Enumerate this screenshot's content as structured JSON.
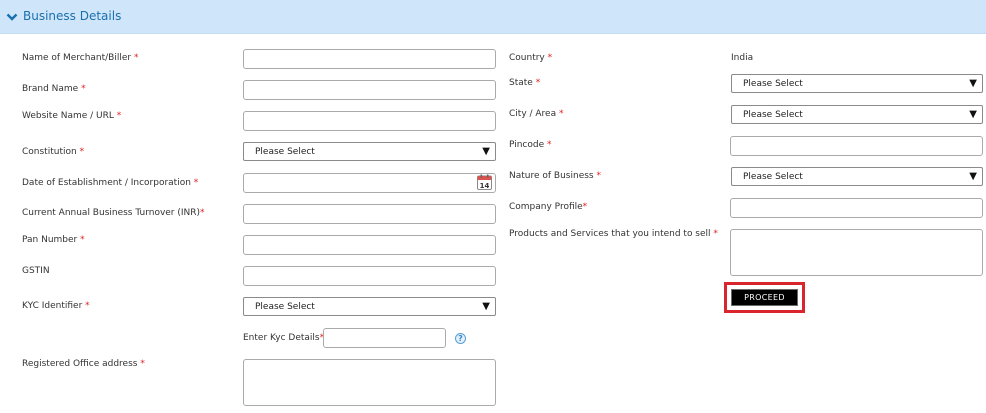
{
  "section": {
    "title": "Business Details"
  },
  "left": {
    "merchant_name": {
      "label": "Name of Merchant/Biller",
      "required": "*",
      "value": ""
    },
    "brand_name": {
      "label": "Brand Name",
      "required": "*",
      "value": ""
    },
    "website": {
      "label": "Website Name / URL",
      "required": "*",
      "value": ""
    },
    "constitution": {
      "label": "Constitution",
      "required": "*",
      "selected": "Please Select"
    },
    "date_establishment": {
      "label": "Date of Establishment / Incorporation",
      "required": "*",
      "value": "",
      "calendar_day": "14"
    },
    "turnover": {
      "label": "Current Annual Business Turnover (INR)",
      "required": "*",
      "value": ""
    },
    "pan": {
      "label": "Pan Number",
      "required": "*",
      "value": ""
    },
    "gstin": {
      "label": "GSTIN",
      "value": ""
    },
    "kyc_identifier": {
      "label": "KYC Identifier",
      "required": "*",
      "selected": "Please Select"
    },
    "kyc_details": {
      "label": "Enter Kyc Details",
      "required": "*",
      "value": "",
      "help": "?"
    },
    "office_address": {
      "label": "Registered Office address",
      "required": "*",
      "value": ""
    }
  },
  "right": {
    "country": {
      "label": "Country",
      "required": "*",
      "value": "India"
    },
    "state": {
      "label": "State",
      "required": "*",
      "selected": "Please Select"
    },
    "city": {
      "label": "City / Area",
      "required": "*",
      "selected": "Please Select"
    },
    "pincode": {
      "label": "Pincode",
      "required": "*",
      "value": ""
    },
    "nature_of_business": {
      "label": "Nature of Business",
      "required": "*",
      "selected": "Please Select"
    },
    "company_profile": {
      "label": "Company Profile",
      "required": "*",
      "value": ""
    },
    "products": {
      "label": "Products and Services that you intend to sell",
      "required": "*",
      "value": ""
    }
  },
  "actions": {
    "proceed_label": "PROCEED"
  },
  "icons": {
    "section_toggle": "chevron-down-icon",
    "date_picker": "calendar-icon",
    "kyc_help": "help-icon",
    "dropdown": "dropdown-arrow-icon"
  },
  "colors": {
    "header_bg": "#cfe6fa",
    "header_text": "#1a6fae",
    "required_mark": "#e02020",
    "button_bg": "#000000",
    "highlight_border": "#d9262e"
  }
}
